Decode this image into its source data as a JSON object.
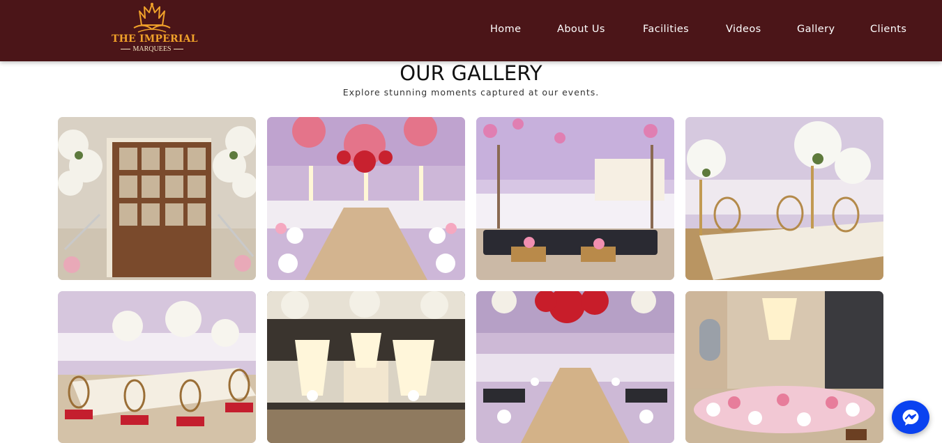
{
  "brand": {
    "title": "THE IMPERIAL",
    "subtitle": "MARQUEES",
    "logo_icon": "crown-icon",
    "colors": {
      "navbar": "#4b1518",
      "logo_gold": "#f0a12a",
      "accent_blue": "#0a42f0"
    }
  },
  "nav": {
    "items": [
      {
        "label": "Home"
      },
      {
        "label": "About Us"
      },
      {
        "label": "Facilities"
      },
      {
        "label": "Videos"
      },
      {
        "label": "Gallery"
      },
      {
        "label": "Clients"
      }
    ]
  },
  "gallery": {
    "title": "OUR GALLERY",
    "subtitle": "Explore stunning moments captured at our events.",
    "images": [
      {
        "subject": "wooden glass doors flanked by white floral stands"
      },
      {
        "subject": "aisle under pink and red floral canopy with chandeliers"
      },
      {
        "subject": "lounge with black tufted sofas and flowering trees"
      },
      {
        "subject": "dining tables with white rose centerpieces"
      },
      {
        "subject": "long banquet table with gold chairs and red cushions"
      },
      {
        "subject": "crystal chandeliers over floral stage"
      },
      {
        "subject": "walkway with red floral ceiling and lights"
      },
      {
        "subject": "round stage with pink flowers under chandelier"
      }
    ]
  },
  "chat_widget": {
    "icon": "messenger-icon"
  }
}
